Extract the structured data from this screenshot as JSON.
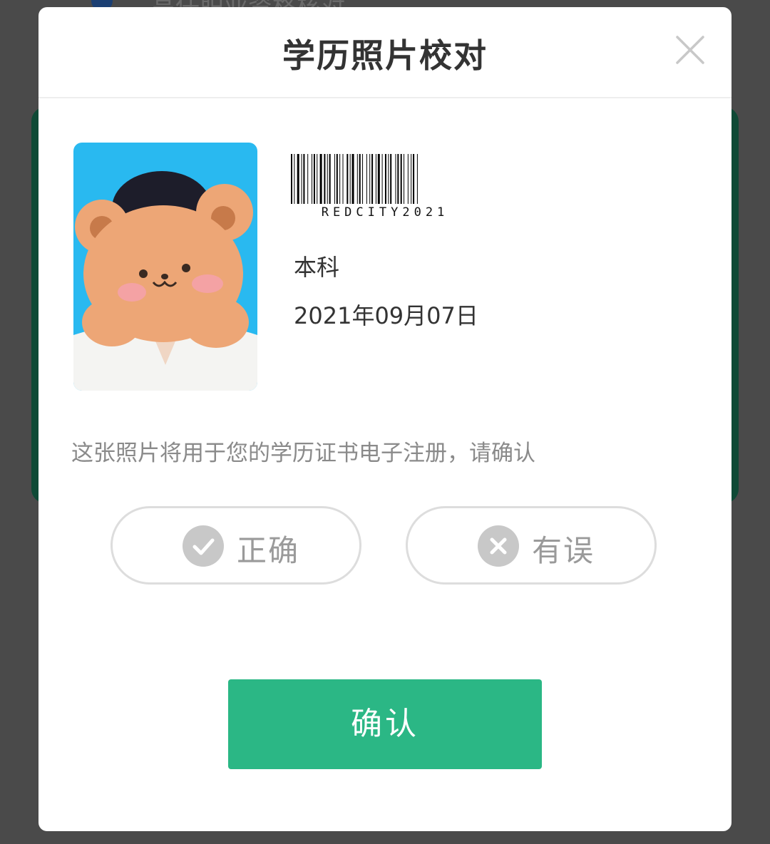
{
  "background": {
    "header_text": "高任职业资格核对"
  },
  "dialog": {
    "title": "学历照片校对",
    "close_icon": "close-icon"
  },
  "record": {
    "barcode_text": "REDCITY2021",
    "degree": "本科",
    "date": "2021年09月07日"
  },
  "notice": "这张照片将用于您的学历证书电子注册，请确认",
  "choices": {
    "correct": {
      "label": "正确",
      "icon": "check-circle-icon"
    },
    "wrong": {
      "label": "有误",
      "icon": "x-circle-icon"
    }
  },
  "confirm_label": "确认",
  "colors": {
    "accent": "#2bb785",
    "overlay": "#4a4a4a",
    "bg_card": "#0f4a36",
    "photo_bg": "#29b9f0",
    "bear": "#eda676"
  }
}
